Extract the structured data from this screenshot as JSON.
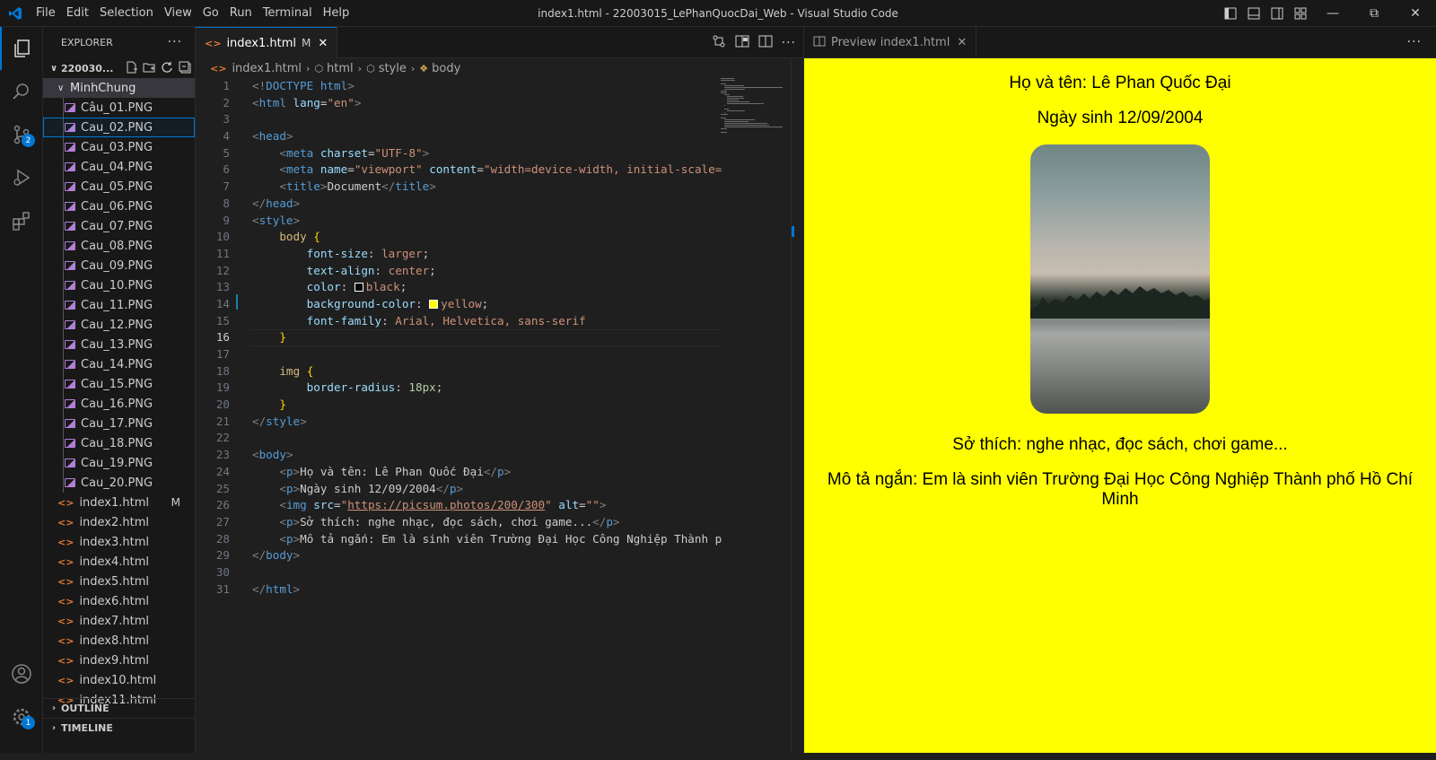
{
  "menu": [
    "File",
    "Edit",
    "Selection",
    "View",
    "Go",
    "Run",
    "Terminal",
    "Help"
  ],
  "window_title": "index1.html - 22003015_LePhanQuocDai_Web - Visual Studio Code",
  "activity": {
    "source_control_badge": "2",
    "settings_badge": "1"
  },
  "explorer": {
    "title": "EXPLORER",
    "workspace": "220030...",
    "folder": "MinhChung",
    "images": [
      "Câu_01.PNG",
      "Cau_02.PNG",
      "Cau_03.PNG",
      "Cau_04.PNG",
      "Cau_05.PNG",
      "Cau_06.PNG",
      "Cau_07.PNG",
      "Cau_08.PNG",
      "Cau_09.PNG",
      "Cau_10.PNG",
      "Cau_11.PNG",
      "Cau_12.PNG",
      "Cau_13.PNG",
      "Cau_14.PNG",
      "Cau_15.PNG",
      "Cau_16.PNG",
      "Cau_17.PNG",
      "Cau_18.PNG",
      "Cau_19.PNG",
      "Cau_20.PNG"
    ],
    "html_files": [
      "index1.html",
      "index2.html",
      "index3.html",
      "index4.html",
      "index5.html",
      "index6.html",
      "index7.html",
      "index8.html",
      "index9.html",
      "index10.html",
      "index11.html"
    ],
    "modified_flag": "M",
    "outline": "OUTLINE",
    "timeline": "TIMELINE"
  },
  "editor": {
    "tab_label": "index1.html",
    "tab_modified": "M",
    "breadcrumb": [
      "index1.html",
      "html",
      "style",
      "body"
    ],
    "current_line": 16,
    "lines": [
      "<!DOCTYPE html>",
      "<html lang=\"en\">",
      "",
      "<head>",
      "    <meta charset=\"UTF-8\">",
      "    <meta name=\"viewport\" content=\"width=device-width, initial-scale=",
      "    <title>Document</title>",
      "</head>",
      "<style>",
      "    body {",
      "        font-size: larger;",
      "        text-align: center;",
      "        color: black;",
      "        background-color: yellow;",
      "        font-family: Arial, Helvetica, sans-serif",
      "    }",
      "",
      "    img {",
      "        border-radius: 18px;",
      "    }",
      "</style>",
      "",
      "<body>",
      "    <p>Họ và tên: Lê Phan Quốc Đại</p>",
      "    <p>Ngày sinh 12/09/2004</p>",
      "    <img src=\"https://picsum.photos/200/300\" alt=\"\">",
      "    <p>Sở thích: nghe nhạc, đọc sách, chơi game...</p>",
      "    <p>Mô tả ngắn: Em là sinh viên Trường Đại Học Công Nghiệp Thành p",
      "</body>",
      "",
      "</html>"
    ]
  },
  "preview": {
    "tab_label": "Preview index1.html",
    "name": "Họ và tên: Lê Phan Quốc Đại",
    "dob": "Ngày sinh 12/09/2004",
    "hobby": "Sở thích: nghe nhạc, đọc sách, chơi game...",
    "desc": "Mô tả ngắn: Em là sinh viên Trường Đại Học Công Nghiệp Thành phố Hồ Chí Minh",
    "background": "#ffff00"
  }
}
